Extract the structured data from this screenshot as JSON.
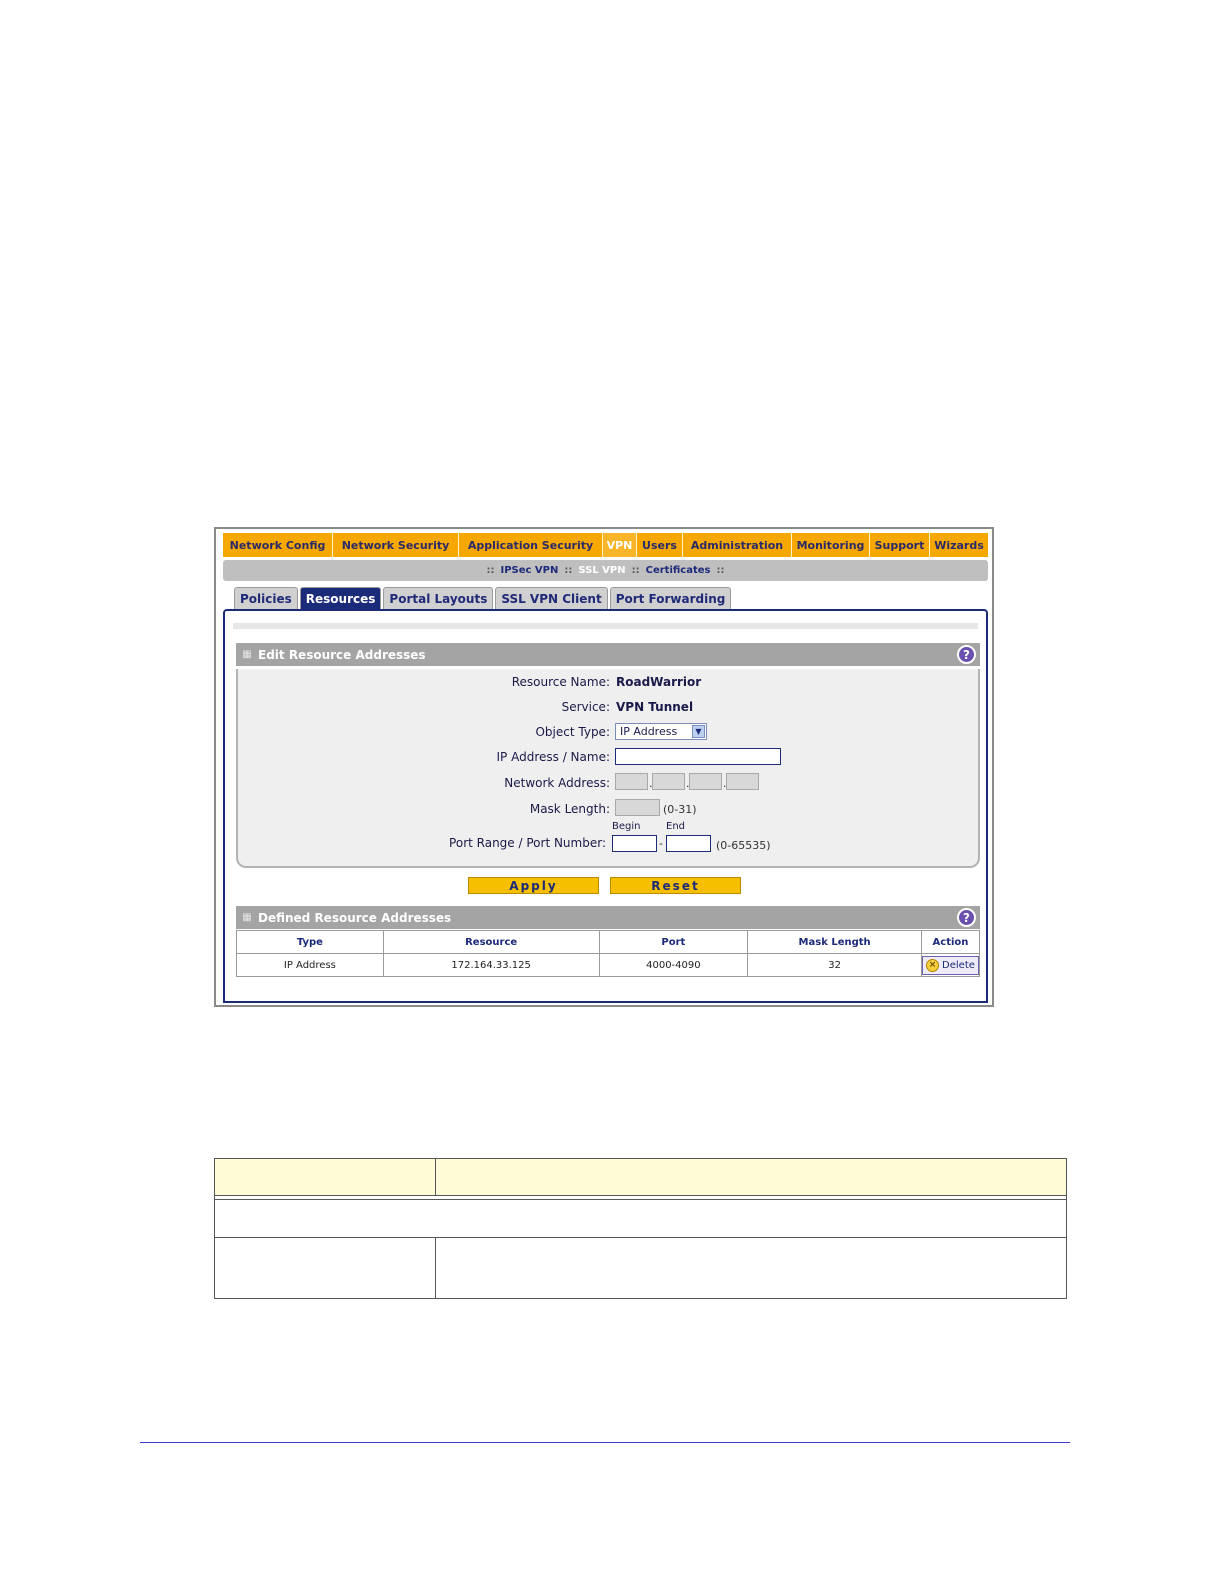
{
  "nav": {
    "items": [
      {
        "label": "Network Config",
        "active": false
      },
      {
        "label": "Network Security",
        "active": false
      },
      {
        "label": "Application Security",
        "active": false
      },
      {
        "label": "VPN",
        "active": true
      },
      {
        "label": "Users",
        "active": false
      },
      {
        "label": "Administration",
        "active": false
      },
      {
        "label": "Monitoring",
        "active": false
      },
      {
        "label": "Support",
        "active": false
      },
      {
        "label": "Wizards",
        "active": false
      }
    ]
  },
  "subnav": {
    "separator": "::",
    "items": [
      {
        "label": "IPSec VPN",
        "active": false
      },
      {
        "label": "SSL VPN",
        "active": true
      },
      {
        "label": "Certificates",
        "active": false
      }
    ]
  },
  "tabs": [
    {
      "label": "Policies",
      "active": false
    },
    {
      "label": "Resources",
      "active": true
    },
    {
      "label": "Portal Layouts",
      "active": false
    },
    {
      "label": "SSL VPN Client",
      "active": false
    },
    {
      "label": "Port Forwarding",
      "active": false
    }
  ],
  "edit_section": {
    "title": "Edit Resource Addresses",
    "help": "?",
    "resource_name_label": "Resource Name:",
    "resource_name_value": "RoadWarrior",
    "service_label": "Service:",
    "service_value": "VPN Tunnel",
    "object_type_label": "Object Type:",
    "object_type_value": "IP Address",
    "ip_name_label": "IP Address / Name:",
    "ip_name_value": "",
    "network_address_label": "Network Address:",
    "mask_length_label": "Mask Length:",
    "mask_length_hint": "(0-31)",
    "port_range_label": "Port Range / Port Number:",
    "port_begin_label": "Begin",
    "port_end_label": "End",
    "port_dash": "-",
    "port_hint": "(0-65535)"
  },
  "buttons": {
    "apply": "Apply",
    "reset": "Reset"
  },
  "defined_section": {
    "title": "Defined Resource Addresses",
    "help": "?",
    "columns": [
      "Type",
      "Resource",
      "Port",
      "Mask Length",
      "Action"
    ],
    "rows": [
      {
        "type": "IP Address",
        "resource": "172.164.33.125",
        "port": "4000-4090",
        "mask": "32",
        "action": "Delete"
      }
    ]
  },
  "colors": {
    "nav_orange": "#f6a800",
    "brand_navy": "#1c2a7a",
    "button_yellow": "#f6c000",
    "doc_header_fill": "#fffbd6",
    "footer_rule": "#3a3ad0"
  },
  "icons": [
    "help-icon",
    "delete-x-icon",
    "chevron-down-icon",
    "grip-icon"
  ]
}
